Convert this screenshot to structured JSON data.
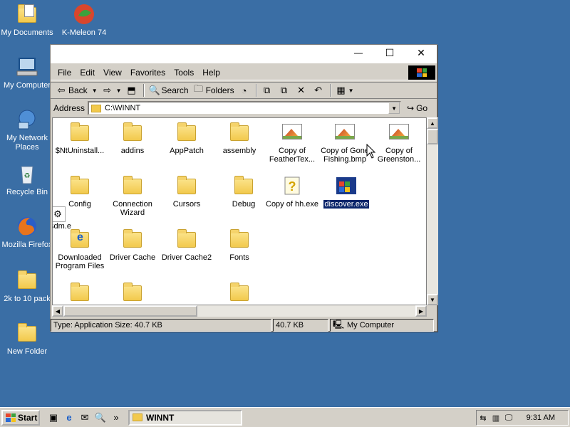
{
  "desktop": {
    "icons": [
      {
        "label": "My Documents",
        "icon": "my-documents-icon"
      },
      {
        "label": "K-Meleon 74",
        "icon": "k-meleon-icon"
      },
      {
        "label": "My Computer",
        "icon": "my-computer-icon"
      },
      {
        "label": "My Network Places",
        "icon": "network-places-icon"
      },
      {
        "label": "Recycle Bin",
        "icon": "recycle-bin-icon"
      },
      {
        "label": "Mozilla Firefox",
        "icon": "firefox-icon"
      },
      {
        "label": "2k to 10 pack",
        "icon": "folder-icon"
      },
      {
        "label": "New Folder",
        "icon": "folder-icon"
      }
    ]
  },
  "window": {
    "controls": {
      "minimize": "—",
      "maximize": "☐",
      "close": "✕"
    },
    "menu": [
      "File",
      "Edit",
      "View",
      "Favorites",
      "Tools",
      "Help"
    ],
    "toolbar": {
      "back_label": "Back",
      "search_label": "Search",
      "folders_label": "Folders"
    },
    "address": {
      "label": "Address",
      "value": "C:\\WINNT",
      "go_label": "Go"
    },
    "files": [
      {
        "label": "$NtUninstall...",
        "type": "folder"
      },
      {
        "label": "addins",
        "type": "folder"
      },
      {
        "label": "AppPatch",
        "type": "folder"
      },
      {
        "label": "assembly",
        "type": "folder"
      },
      {
        "label": "Copy of FeatherTex...",
        "type": "bmp"
      },
      {
        "label": "Copy of Gone Fishing.bmp",
        "type": "bmp"
      },
      {
        "label": "Copy of Greenston...",
        "type": "bmp"
      },
      {
        "label": "Config",
        "type": "folder"
      },
      {
        "label": "Connection Wizard",
        "type": "folder"
      },
      {
        "label": "Cursors",
        "type": "folder"
      },
      {
        "label": "Debug",
        "type": "folder"
      },
      {
        "label": "Copy of hh.exe",
        "type": "help"
      },
      {
        "label": "discover.exe",
        "type": "exe",
        "selected": true
      },
      {
        "label": "Downloaded Program Files",
        "type": "ie-folder"
      },
      {
        "label": "Driver Cache",
        "type": "folder"
      },
      {
        "label": "Driver Cache2",
        "type": "folder"
      },
      {
        "label": "Fonts",
        "type": "folder"
      },
      {
        "label": "",
        "type": "folder"
      },
      {
        "label": "",
        "type": "folder"
      },
      {
        "label": "",
        "type": "folder"
      }
    ],
    "dragged_label": "sdm.e",
    "status": {
      "type_text": "Type: Application Size: 40.7 KB",
      "size_text": "40.7 KB",
      "zone_text": "My Computer"
    }
  },
  "taskbar": {
    "start_label": "Start",
    "quick_launch_more": "»",
    "task_label": "WINNT",
    "clock": "9:31 AM"
  }
}
